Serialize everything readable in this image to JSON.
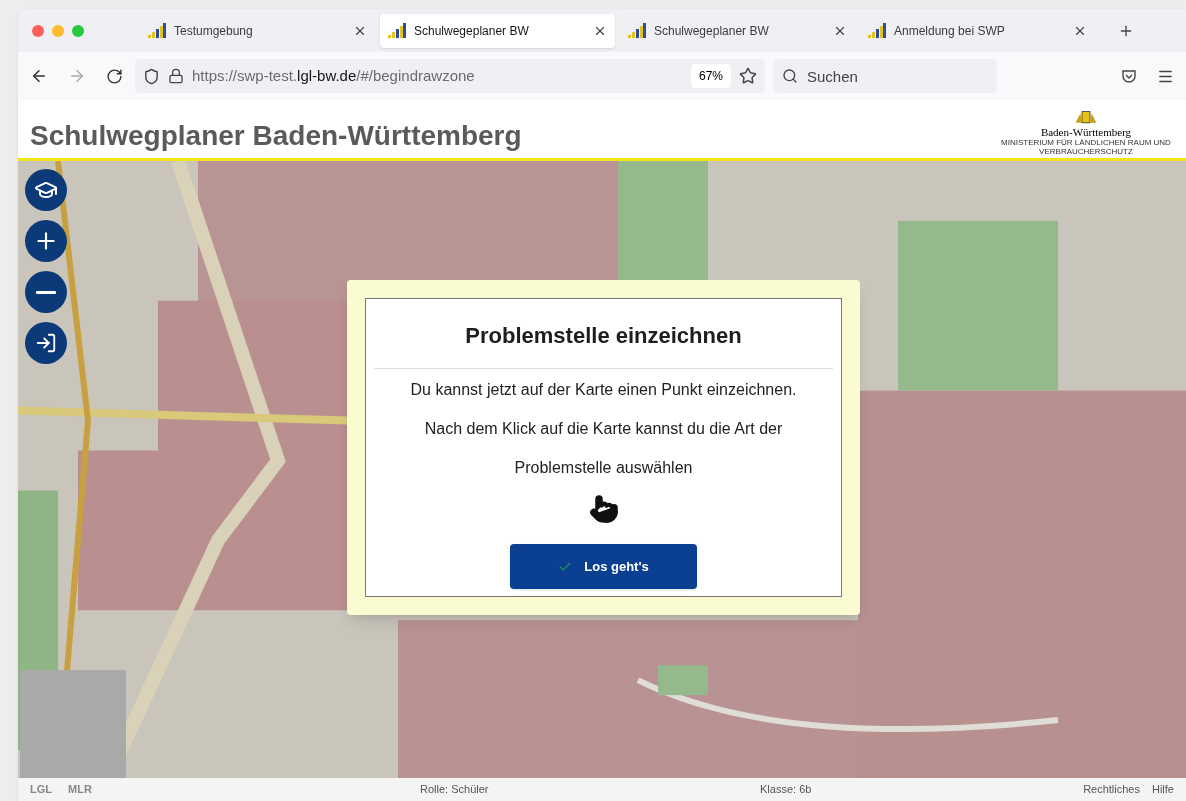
{
  "browser": {
    "tabs": [
      {
        "title": "Testumgebung",
        "selected": false
      },
      {
        "title": "Schulwegeplaner BW",
        "selected": true
      },
      {
        "title": "Schulwegeplaner BW",
        "selected": false
      },
      {
        "title": "Anmeldung bei SWP",
        "selected": false
      }
    ],
    "address": {
      "prefix": "https://swp-test.",
      "domain": "lgl-bw.de",
      "path": "/#/begindrawzone"
    },
    "zoom": "67%",
    "search": {
      "placeholder": "Suchen"
    }
  },
  "header": {
    "title": "Schulwegplaner Baden-Württemberg",
    "logo_text": "Baden-Württemberg",
    "logo_subtext": "MINISTERIUM FÜR LÄNDLICHEN RAUM UND VERBRAUCHERSCHUTZ"
  },
  "map": {
    "kind": "picture",
    "controls": [
      {
        "kind": "school"
      },
      {
        "kind": "zoom-in"
      },
      {
        "kind": "zoom-out"
      },
      {
        "kind": "login"
      }
    ]
  },
  "dialog": {
    "title": "Problemstelle einzeichnen",
    "paragraphs": [
      "Du kannst jetzt auf der Karte einen Punkt einzeichnen.",
      "Nach dem Klick auf die Karte kannst du die Art der",
      "Problemstelle auswählen"
    ],
    "button": "Los geht's"
  },
  "status_bar": {
    "logos": [
      "LGL",
      "MLR"
    ],
    "role": "Rolle: Schüler",
    "class": "Klasse: 6b",
    "links": [
      "Rechtliches",
      "Hilfe"
    ]
  }
}
